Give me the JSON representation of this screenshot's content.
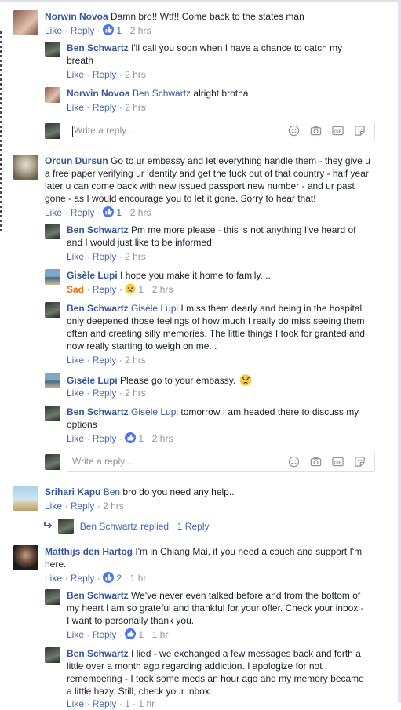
{
  "labels": {
    "like": "Like",
    "reply": "Reply",
    "sad": "Sad",
    "write_placeholder": "Write a reply...",
    "replied": "replied",
    "sep": "·"
  },
  "comments": [
    {
      "author": "Norwin Novoa",
      "text": "Damn bro!! Wtf!! Come back to the states man",
      "likes": "1",
      "time": "2 hrs"
    },
    {
      "author": "Ben Schwartz",
      "text": "I'll call you soon when I have a chance to catch my breath",
      "time": "2 hrs"
    },
    {
      "author": "Norwin Novoa",
      "mention": "Ben Schwartz",
      "text": "alright brotha",
      "time": "2 hrs"
    },
    {
      "author": "Orcun Dursun",
      "text": "Go to ur embassy and let everything handle them - they give u a free paper verifying ur identity and get the fuck out of that country - half year later u can come back with new issued passport new number - and ur past gone - as I would encourage you to let it gone. Sorry to hear that!",
      "likes": "1",
      "time": "2 hrs"
    },
    {
      "author": "Ben Schwartz",
      "text": "Pm me more please - this is not anything I've heard of and I would just like to be informed",
      "time": "2 hrs"
    },
    {
      "author": "Gisèle Lupi",
      "text": "I hope you make it home to family....",
      "likes": "1",
      "time": "2 hrs"
    },
    {
      "author": "Ben Schwartz",
      "mention": "Gisèle Lupi",
      "text": "I miss them dearly and being in the hospital only deepened those feelings of how much I really do miss seeing them often and creating silly memories. The little things I took for granted and now really starting to weigh on me...",
      "time": "2 hrs"
    },
    {
      "author": "Gisèle Lupi",
      "text": "Please go to your embassy.",
      "time": "2 hrs"
    },
    {
      "author": "Ben Schwartz",
      "mention": "Gisèle Lupi",
      "text": "tomorrow I am headed there to discuss my options",
      "likes": "1",
      "time": "2 hrs"
    },
    {
      "author": "Srihari Kapu",
      "mention": "Ben",
      "text": "bro do you need any help..",
      "time": "2 hrs"
    },
    {
      "author": "Matthijs den Hartog",
      "text": "I'm in Chiang Mai, if you need a couch and support I'm here.",
      "likes": "2",
      "time": "1 hr"
    },
    {
      "author": "Ben Schwartz",
      "text": "We've never even talked before and from the bottom of my heart I am so grateful and thankful for your offer. Check your inbox - I want to personally thank you.",
      "likes": "1",
      "time": "1 hr"
    },
    {
      "author": "Ben Schwartz",
      "text": "I lied - we exchanged a few messages back and forth a little over a month ago regarding addiction. I apologize for not remembering - I took some meds an hour ago and my memory became a little hazy. Still, check your inbox.",
      "likes": "1",
      "time": "1 hr"
    }
  ],
  "replies_summary": {
    "author": "Ben Schwartz",
    "count": "1 Reply"
  },
  "colors": {
    "link": "#365899",
    "action": "#4267b2",
    "muted": "#90949c",
    "sad": "#e9710f"
  },
  "icons": [
    "like-reaction-icon",
    "sad-reaction-icon",
    "emoji-icon",
    "camera-icon",
    "gif-icon",
    "sticker-icon",
    "reply-arrow-icon"
  ]
}
